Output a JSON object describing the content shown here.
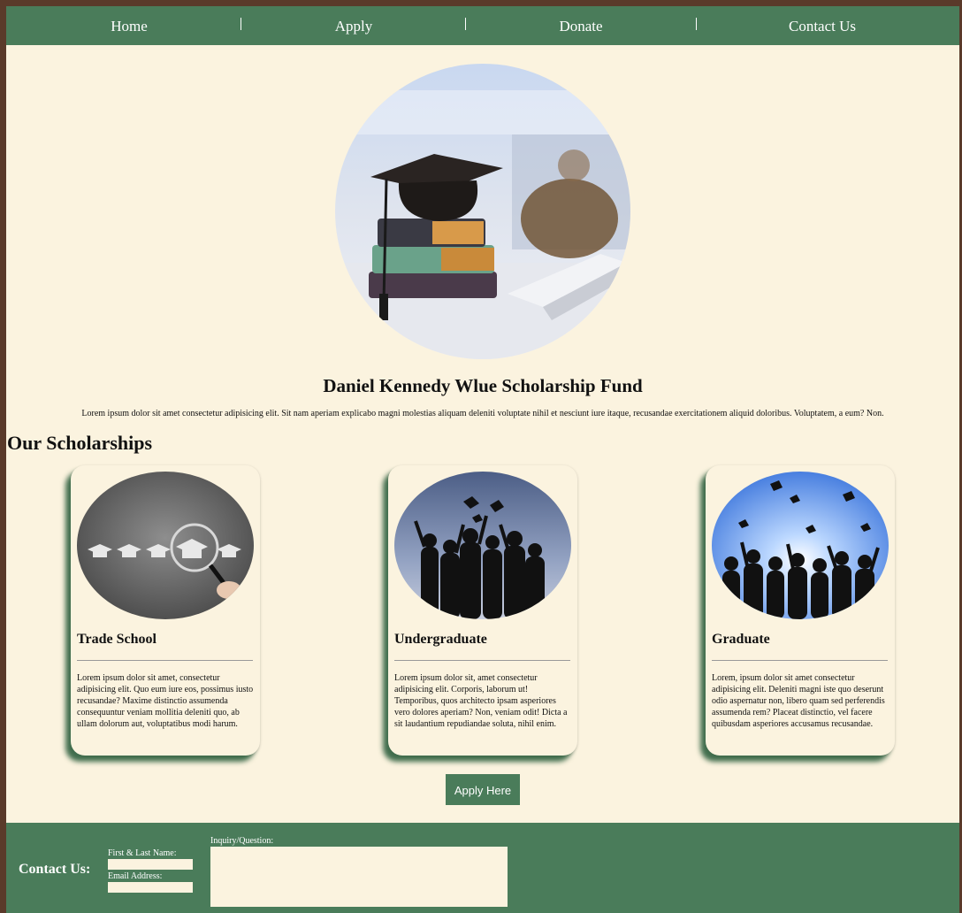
{
  "nav": {
    "items": [
      "Home",
      "Apply",
      "Donate",
      "Contact Us"
    ],
    "separator": "|"
  },
  "hero": {
    "image": "graduation-cap-on-books-photo",
    "title": "Daniel Kennedy Wlue Scholarship Fund",
    "text": "Lorem ipsum dolor sit amet consectetur adipisicing elit. Sit nam aperiam explicabo magni molestias aliquam deleniti voluptate nihil et nesciunt iure itaque, recusandae exercitationem aliquid doloribus. Voluptatem, a eum? Non."
  },
  "scholarships": {
    "heading": "Our Scholarships",
    "cards": [
      {
        "title": "Trade School",
        "image": "chalkboard-caps-magnifier-photo",
        "text": "Lorem ipsum dolor sit amet, consectetur adipisicing elit. Quo eum iure eos, possimus iusto recusandae? Maxime distinctio assumenda consequuntur veniam mollitia deleniti quo, ab ullam dolorum aut, voluptatibus modi harum."
      },
      {
        "title": "Undergraduate",
        "image": "graduates-silhouette-dusk-photo",
        "text": "Lorem ipsum dolor sit, amet consectetur adipisicing elit. Corporis, laborum ut! Temporibus, quos architecto ipsam asperiores vero dolores aperiam? Non, veniam odit! Dicta a sit laudantium repudiandae soluta, nihil enim."
      },
      {
        "title": "Graduate",
        "image": "graduates-silhouette-sky-photo",
        "text": "Lorem, ipsum dolor sit amet consectetur adipisicing elit. Deleniti magni iste quo deserunt odio aspernatur non, libero quam sed perferendis assumenda rem? Placeat distinctio, vel facere quibusdam asperiores accusamus recusandae."
      }
    ],
    "apply_button": "Apply Here"
  },
  "footer": {
    "title": "Contact Us:",
    "name_label": "First & Last Name:",
    "email_label": "Email Address:",
    "inquiry_label": "Inquiry/Question:",
    "name_value": "",
    "email_value": "",
    "inquiry_value": ""
  },
  "colors": {
    "primary_green": "#4a7c5a",
    "background_cream": "#fbf3df",
    "outer_frame": "#5a3a2a"
  }
}
